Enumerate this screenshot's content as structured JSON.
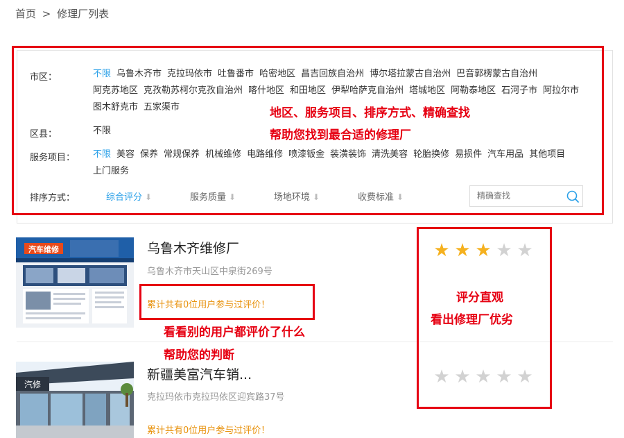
{
  "breadcrumb": {
    "home": "首页",
    "sep": ">",
    "current": "修理厂列表"
  },
  "filters": {
    "city_label": "市区：",
    "city_options": [
      "不限",
      "乌鲁木齐市",
      "克拉玛依市",
      "吐鲁番市",
      "哈密地区",
      "昌吉回族自治州",
      "博尔塔拉蒙古自治州",
      "巴音郭楞蒙古自治州",
      "阿克苏地区",
      "克孜勒苏柯尔克孜自治州",
      "喀什地区",
      "和田地区",
      "伊犁哈萨克自治州",
      "塔城地区",
      "阿勒泰地区",
      "石河子市",
      "阿拉尔市",
      "图木舒克市",
      "五家渠市"
    ],
    "county_label": "区县：",
    "county_options": [
      "不限"
    ],
    "service_label": "服务项目：",
    "service_options": [
      "不限",
      "美容",
      "保养",
      "常规保养",
      "机械维修",
      "电路维修",
      "喷漆钣金",
      "装潢装饰",
      "清洗美容",
      "轮胎换修",
      "易损件",
      "汽车用品",
      "其他项目",
      "上门服务"
    ],
    "sort_label": "排序方式：",
    "sort_options": [
      "综合评分",
      "服务质量",
      "场地环境",
      "收费标准"
    ],
    "search_placeholder": "精确查找"
  },
  "annotations": {
    "filter_line1": "地区、服务项目、排序方式、精确查找",
    "filter_line2": "帮助您找到最合适的修理厂",
    "review_line1": "看看别的用户都评价了什么",
    "review_line2": "帮助您的判断",
    "rating_line1": "评分直观",
    "rating_line2": "看出修理厂优劣"
  },
  "shops": [
    {
      "name": "乌鲁木齐维修厂",
      "address": "乌鲁木齐市天山区中泉街269号",
      "review_text": "累计共有0位用户参与过评价！",
      "rating": 3,
      "max_rating": 5,
      "thumb_sign": "汽车维修"
    },
    {
      "name": "新疆美富汽车销...",
      "address": "克拉玛依市克拉玛依区迎宾路37号",
      "review_text": "累计共有0位用户参与过评价！",
      "rating": 0,
      "max_rating": 5,
      "thumb_sign": "汽修"
    }
  ],
  "colors": {
    "accent": "#2aa0e8",
    "annotation_red": "#e60012",
    "star_on": "#f5b11f",
    "star_off": "#d2d2d2",
    "review": "#e8920c"
  }
}
